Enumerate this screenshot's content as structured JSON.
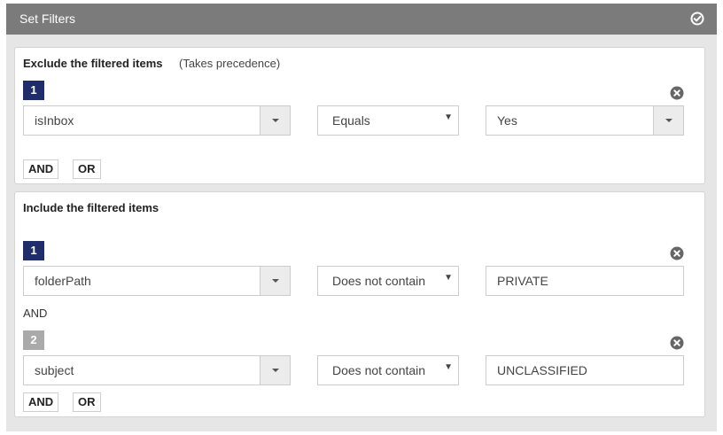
{
  "header": {
    "title": "Set Filters",
    "confirm_icon": "check-circle-icon"
  },
  "exclude": {
    "title": "Exclude the filtered items",
    "note": "(Takes precedence)",
    "conditions": [
      {
        "number": "1",
        "field": "isInbox",
        "operator": "Equals",
        "value": "Yes",
        "value_type": "dropdown"
      }
    ],
    "and_label": "AND",
    "or_label": "OR"
  },
  "include": {
    "title": "Include the filtered items",
    "conditions": [
      {
        "number": "1",
        "field": "folderPath",
        "operator": "Does not contain",
        "value": "PRIVATE",
        "value_type": "text"
      },
      {
        "number": "2",
        "field": "subject",
        "operator": "Does not contain",
        "value": "UNCLASSIFIED",
        "value_type": "text"
      }
    ],
    "joiner": "AND",
    "and_label": "AND",
    "or_label": "OR"
  },
  "colors": {
    "header_bg": "#7b7b7b",
    "badge_active": "#1f2d6b",
    "badge_inactive": "#aaaaaa"
  }
}
